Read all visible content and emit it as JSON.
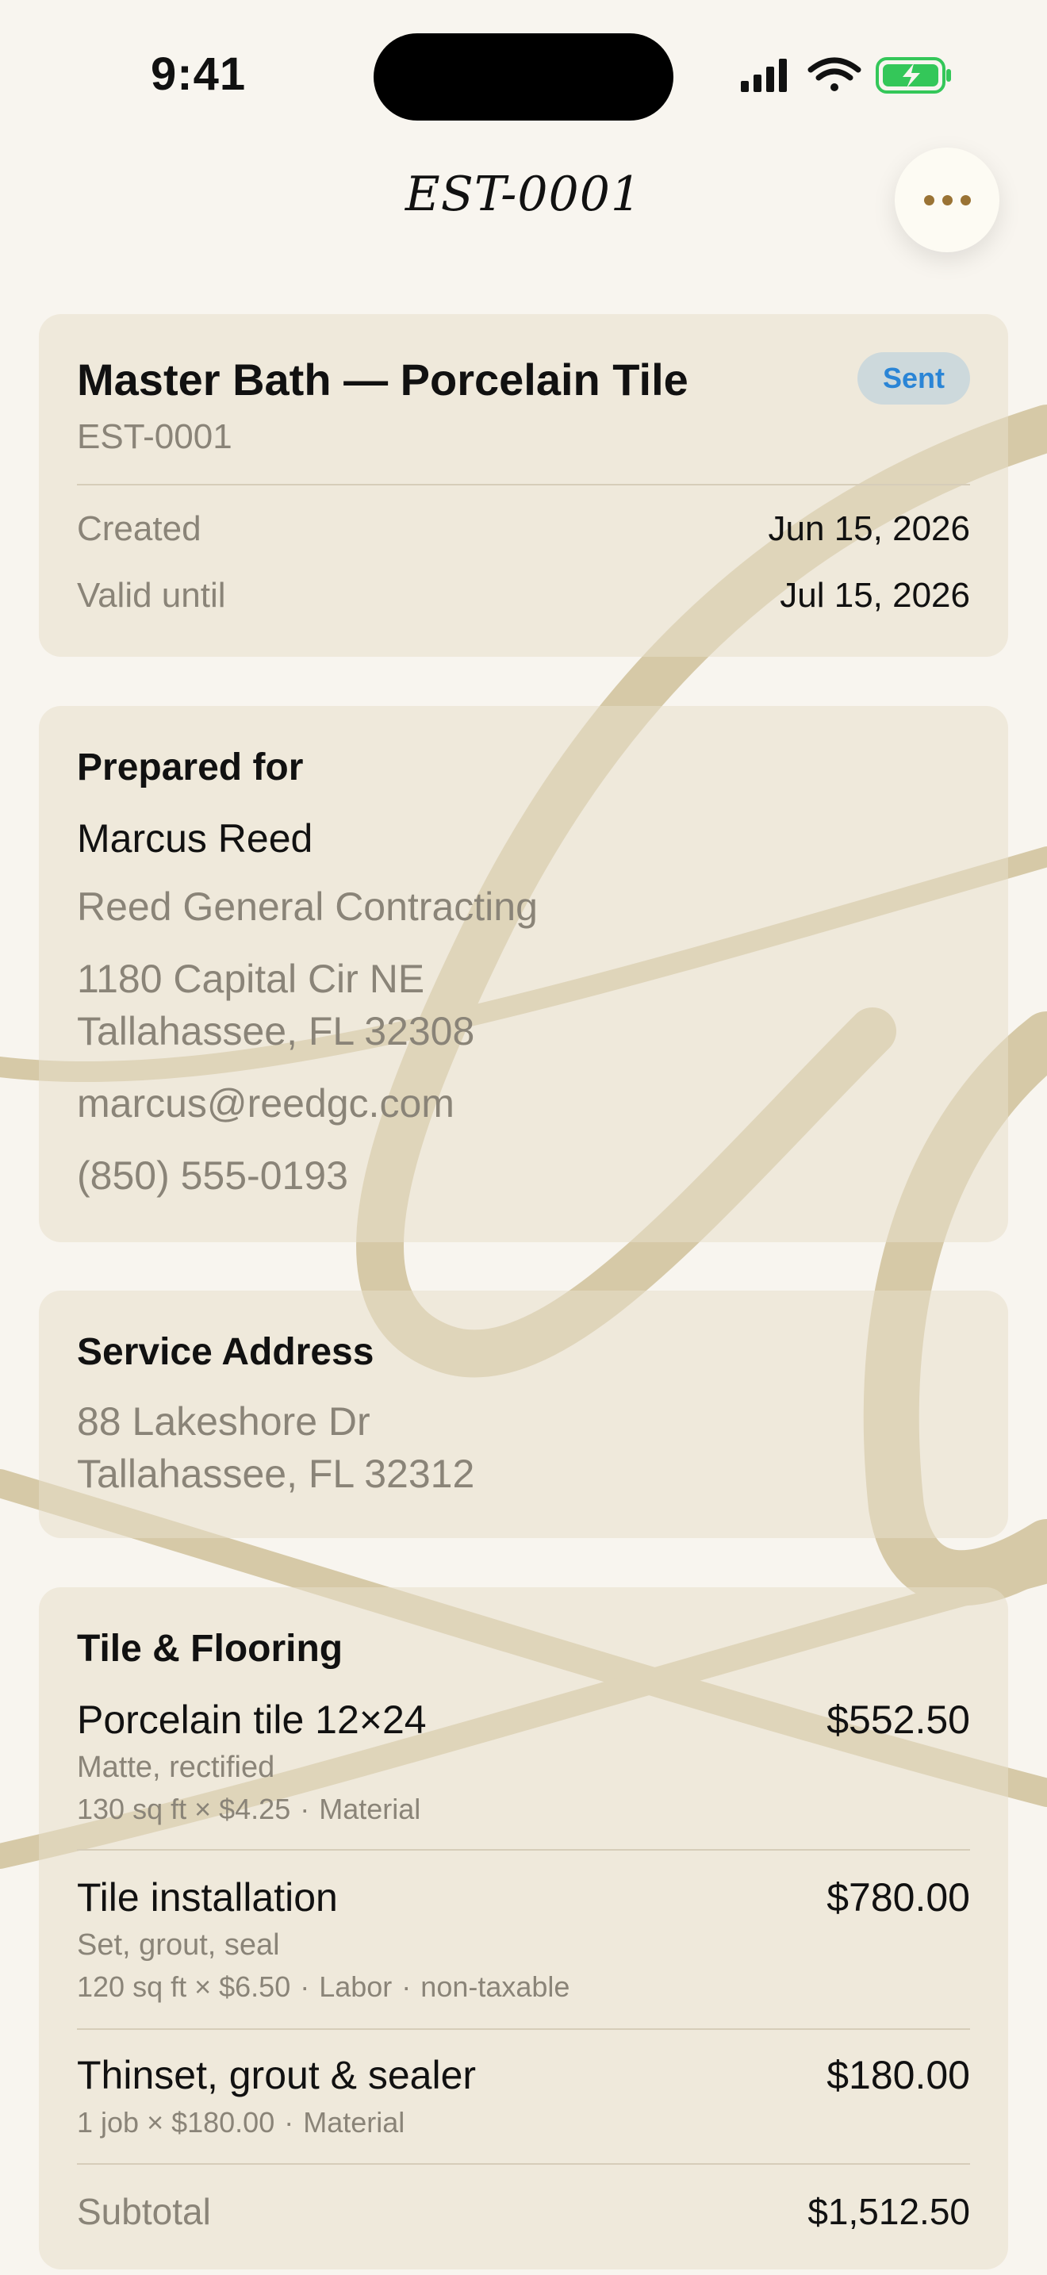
{
  "status_bar": {
    "time": "9:41"
  },
  "nav": {
    "title": "EST-0001"
  },
  "estimate": {
    "title": "Master Bath — Porcelain Tile",
    "status": "Sent",
    "number": "EST-0001",
    "created_label": "Created",
    "created_value": "Jun 15, 2026",
    "valid_label": "Valid until",
    "valid_value": "Jul 15, 2026"
  },
  "client": {
    "heading": "Prepared for",
    "name": "Marcus Reed",
    "company": "Reed General Contracting",
    "address_line1": "1180 Capital Cir NE",
    "address_line2": "Tallahassee, FL 32308",
    "email": "marcus@reedgc.com",
    "phone": "(850) 555-0193"
  },
  "service": {
    "heading": "Service Address",
    "line1": "88 Lakeshore Dr",
    "line2": "Tallahassee, FL 32312"
  },
  "items_section": {
    "heading": "Tile & Flooring",
    "items": [
      {
        "name": "Porcelain tile 12×24",
        "price": "$552.50",
        "desc": "Matte, rectified",
        "qty": "130 sq ft × $4.25",
        "type": "Material",
        "extra": ""
      },
      {
        "name": "Tile installation",
        "price": "$780.00",
        "desc": "Set, grout, seal",
        "qty": "120 sq ft × $6.50",
        "type": "Labor",
        "extra": "non-taxable"
      },
      {
        "name": "Thinset, grout & sealer",
        "price": "$180.00",
        "desc": "",
        "qty": "1 job × $180.00",
        "type": "Material",
        "extra": ""
      }
    ],
    "subtotal_label": "Subtotal",
    "subtotal_value": "$1,512.50"
  },
  "separator": "·",
  "colors": {
    "accent": "#9a7334",
    "badge_text": "#2a85d6",
    "badge_bg": "#cdd9dc",
    "flourish": "#d6c9a7"
  }
}
